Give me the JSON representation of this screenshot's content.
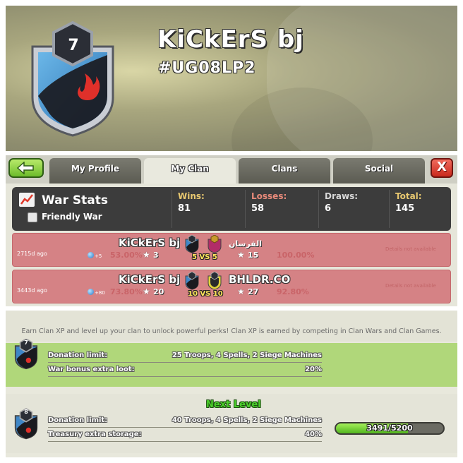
{
  "header": {
    "clan_level": "7",
    "clan_name": "KiCkErS bj",
    "clan_tag": "#UG08LP2"
  },
  "tabs": [
    {
      "label": "My Profile",
      "active": false
    },
    {
      "label": "My Clan",
      "active": true
    },
    {
      "label": "Clans",
      "active": false
    },
    {
      "label": "Social",
      "active": false
    }
  ],
  "close_label": "X",
  "war_stats": {
    "title": "War Stats",
    "friendly_war_label": "Friendly War",
    "wins_label": "Wins:",
    "wins": "81",
    "losses_label": "Losses:",
    "losses": "58",
    "draws_label": "Draws:",
    "draws": "6",
    "total_label": "Total:",
    "total": "145",
    "colors": {
      "wins": "#e8c870",
      "losses": "#e88a7a",
      "draws": "#d8d8d8",
      "total": "#e8c870"
    }
  },
  "wars": [
    {
      "ago": "2715d ago",
      "xp": "+5",
      "our_pct": "53.00%",
      "our_stars": "3",
      "our_name": "KiCkErS bj",
      "our_badge_level": "7",
      "opp_badge_level": "9",
      "vs": "5 VS 5",
      "opp_name": "الفرسان",
      "opp_stars": "15",
      "opp_pct": "100.00%",
      "details": "Details not available"
    },
    {
      "ago": "3443d ago",
      "xp": "+80",
      "our_pct": "73.80%",
      "our_stars": "20",
      "our_name": "KiCkErS bj",
      "our_badge_level": "5",
      "opp_badge_level": "8",
      "vs": "10 VS 10",
      "opp_name": "BHLDR.CO",
      "opp_stars": "27",
      "opp_pct": "92.80%",
      "details": "Details not available"
    }
  ],
  "perks": {
    "intro": "Earn Clan XP and level up your clan to unlock powerful perks! Clan XP is earned by competing in Clan Wars and Clan Games.",
    "current": {
      "level": "7",
      "rows": [
        {
          "label": "Donation limit:",
          "value": "25 Troops, 4 Spells, 2 Siege Machines"
        },
        {
          "label": "War bonus extra loot:",
          "value": "20%"
        }
      ]
    },
    "next": {
      "title": "Next Level",
      "level": "8",
      "rows": [
        {
          "label": "Donation limit:",
          "value": "40 Troops, 4 Spells, 2 Siege Machines"
        },
        {
          "label": "Treasury extra storage:",
          "value": "40%"
        }
      ],
      "xp_text": "3491/5200",
      "xp_current": 3491,
      "xp_max": 5200
    }
  }
}
